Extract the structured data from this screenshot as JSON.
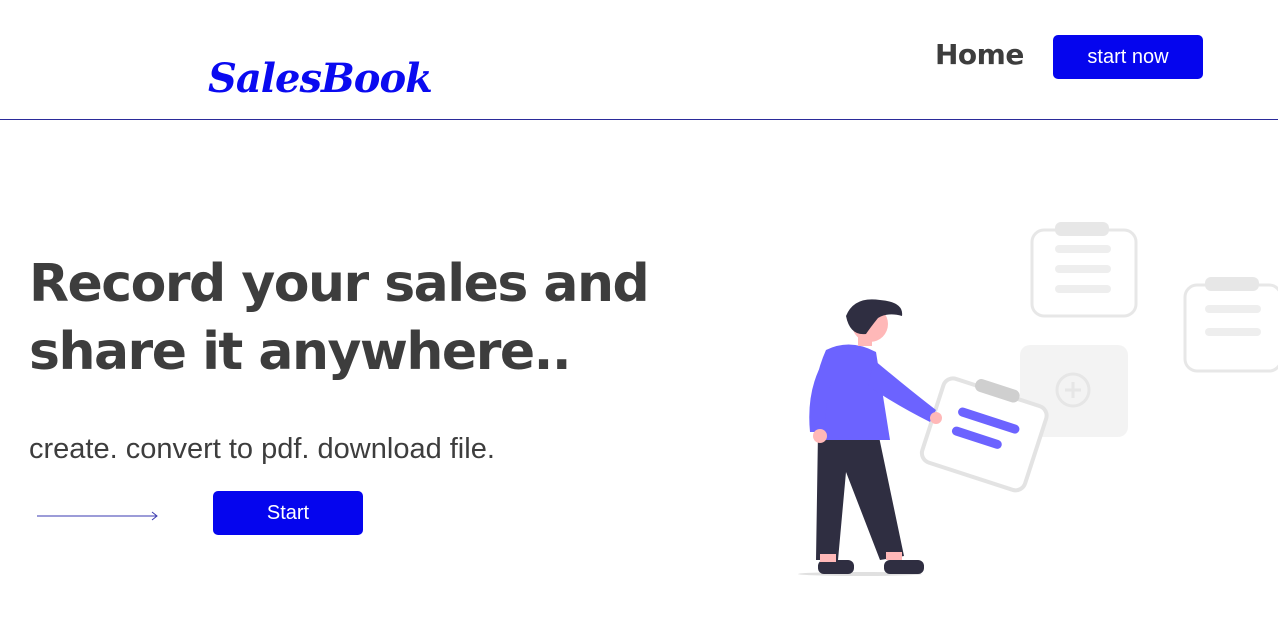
{
  "header": {
    "logo": "SalesBook",
    "nav_home": "Home",
    "cta_label": "start now"
  },
  "hero": {
    "title_line1": "Record your sales and",
    "title_line2": "share it anywhere..",
    "subtitle": "create. convert to pdf. download file.",
    "start_label": "Start",
    "arrow_icon": "long-arrow-right-icon",
    "illustration": "person-holding-document-illustration"
  },
  "colors": {
    "brand_blue": "#0505ee",
    "text_dark": "#3d3d3d",
    "figure_shirt": "#6c63ff",
    "figure_pants": "#2f2e41"
  }
}
